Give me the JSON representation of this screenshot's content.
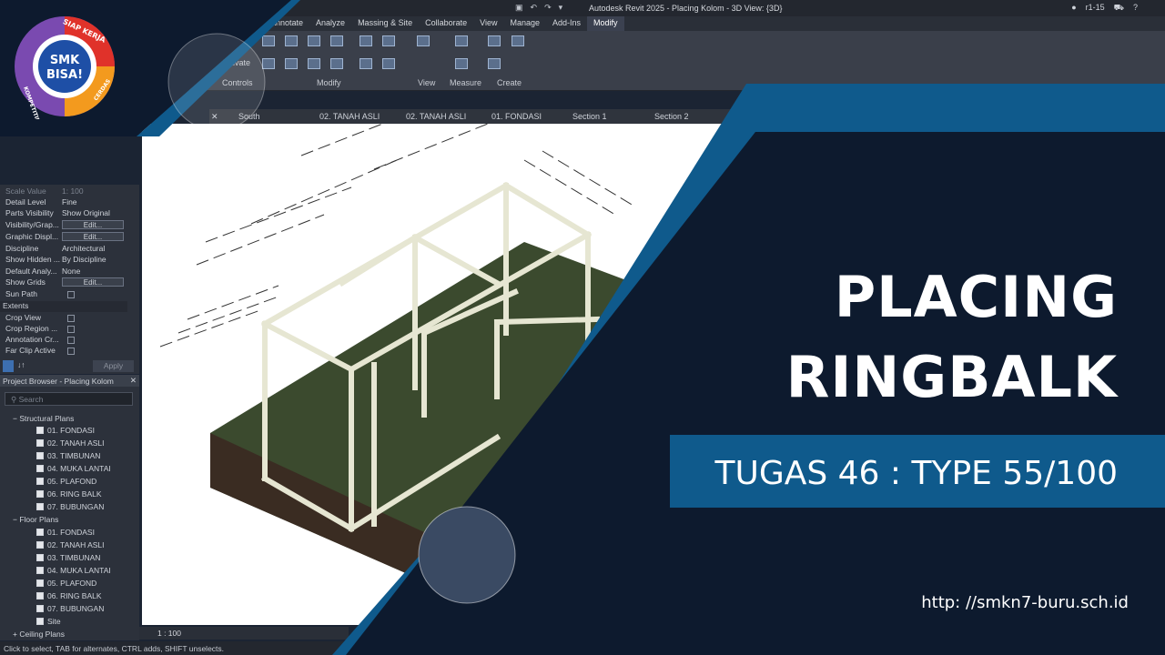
{
  "app": {
    "title": "Autodesk Revit 2025 - Placing Kolom - 3D View: {3D}",
    "user": "r1-15"
  },
  "ribbon_tabs": [
    "Annotate",
    "Analyze",
    "Massing & Site",
    "Collaborate",
    "View",
    "Manage",
    "Add-Ins",
    "Modify"
  ],
  "ribbon_groups": {
    "activate": "Activate",
    "controls": "Controls",
    "modify": "Modify",
    "view": "View",
    "measure": "Measure",
    "create": "Create"
  },
  "view_tabs": [
    "South",
    "02. TANAH ASLI",
    "02. TANAH ASLI",
    "01. FONDASI",
    "Section 1",
    "Section 2"
  ],
  "properties": {
    "scale_label": "Scale Value",
    "scale_value": "1: 100",
    "rows": [
      {
        "k": "Detail Level",
        "v": "Fine"
      },
      {
        "k": "Parts Visibility",
        "v": "Show Original"
      },
      {
        "k": "Visibility/Grap...",
        "v": "Edit..."
      },
      {
        "k": "Graphic Displ...",
        "v": "Edit..."
      },
      {
        "k": "Discipline",
        "v": "Architectural"
      },
      {
        "k": "Show Hidden ...",
        "v": "By Discipline"
      },
      {
        "k": "Default Analy...",
        "v": "None"
      },
      {
        "k": "Show Grids",
        "v": "Edit..."
      },
      {
        "k": "Sun Path",
        "v": ""
      }
    ],
    "extents_label": "Extents",
    "extents_rows": [
      "Crop View",
      "Crop Region ...",
      "Annotation Cr...",
      "Far Clip Active"
    ],
    "apply": "Apply"
  },
  "browser": {
    "title": "Project Browser - Placing Kolom",
    "search_placeholder": "Search",
    "structural_label": "Structural Plans",
    "structural_items": [
      "01. FONDASI",
      "02. TANAH ASLI",
      "03. TIMBUNAN",
      "04. MUKA LANTAI",
      "05. PLAFOND",
      "06. RING BALK",
      "07. BUBUNGAN"
    ],
    "floor_label": "Floor Plans",
    "floor_items": [
      "01. FONDASI",
      "02. TANAH ASLI",
      "03. TIMBUNAN",
      "04. MUKA LANTAI",
      "05. PLAFOND",
      "06. RING BALK",
      "07. BUBUNGAN",
      "Site"
    ],
    "ceiling_label": "Ceiling Plans"
  },
  "viewbar": {
    "scale": "1 : 100"
  },
  "status": "Click to select, TAB for alternates, CTRL adds, SHIFT unselects.",
  "headline": {
    "line1": "PLACING",
    "line2": "RINGBALK"
  },
  "subtitle": "TUGAS 46 : TYPE 55/100",
  "url": "http: //smkn7-buru.sch.id",
  "logo": {
    "top": "SIAP KERJA",
    "center1": "SMK",
    "center2": "BISA!",
    "left": "KOMPETITIF",
    "right": "CERDAS"
  },
  "colors": {
    "navy": "#0d1a2e",
    "blue": "#0f5a8c",
    "logo_red": "#e0322a",
    "logo_orange": "#f39a1e",
    "logo_purple": "#7a4ab0"
  }
}
